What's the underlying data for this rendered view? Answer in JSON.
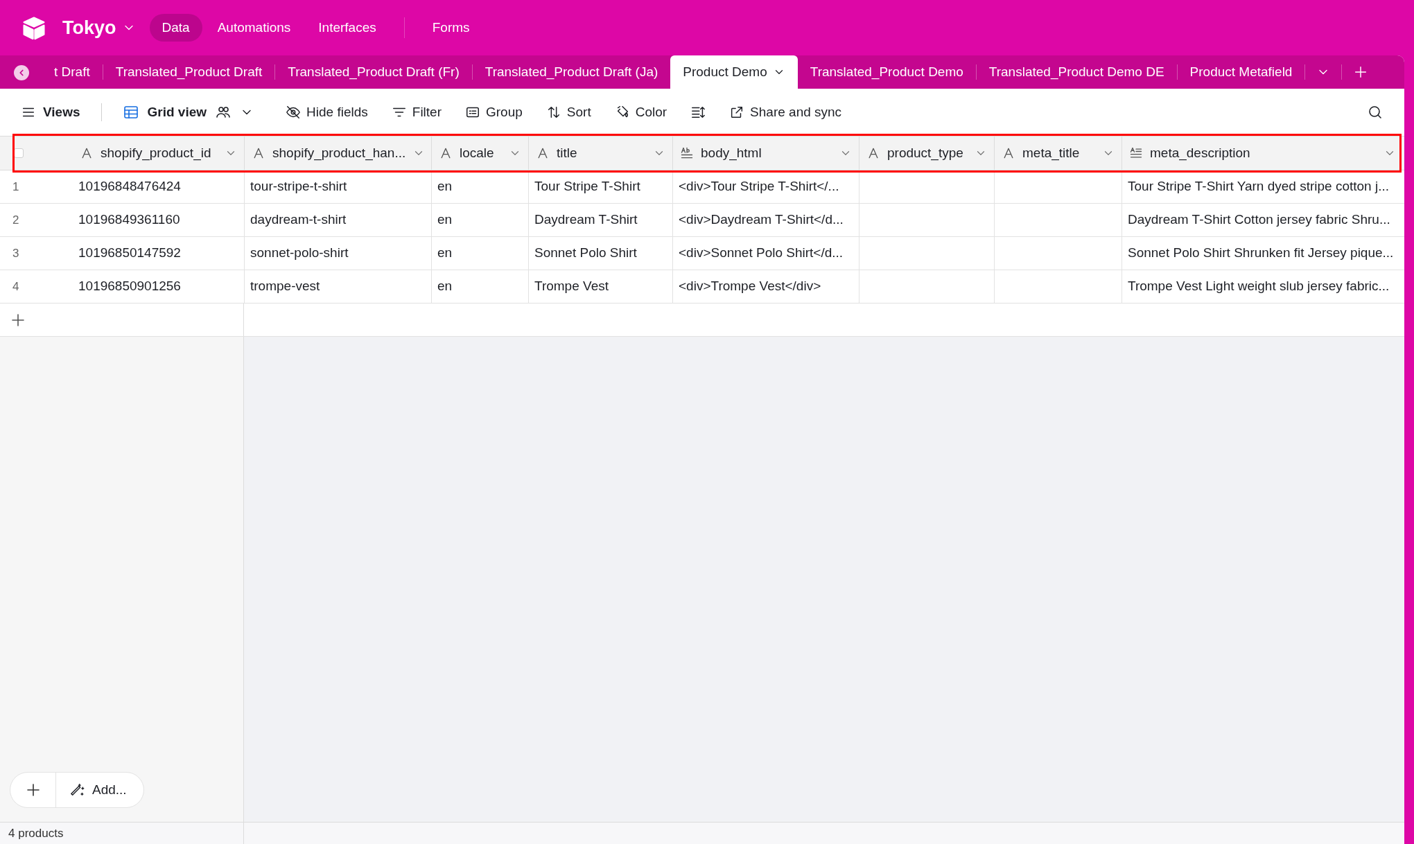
{
  "base": {
    "name": "Tokyo"
  },
  "nav": [
    {
      "label": "Data",
      "selected": true
    },
    {
      "label": "Automations",
      "selected": false
    },
    {
      "label": "Interfaces",
      "selected": false
    },
    {
      "label": "Forms",
      "selected": false
    }
  ],
  "tables": [
    {
      "label": "t Draft",
      "selected": false
    },
    {
      "label": "Translated_Product Draft",
      "selected": false
    },
    {
      "label": "Translated_Product Draft (Fr)",
      "selected": false
    },
    {
      "label": "Translated_Product Draft (Ja)",
      "selected": false
    },
    {
      "label": "Product Demo",
      "selected": true
    },
    {
      "label": "Translated_Product Demo",
      "selected": false
    },
    {
      "label": "Translated_Product Demo DE",
      "selected": false
    },
    {
      "label": "Product Metafield",
      "selected": false
    }
  ],
  "toolbar": {
    "views": "Views",
    "view_name": "Grid view",
    "items": [
      {
        "kind": "hide",
        "label": "Hide fields"
      },
      {
        "kind": "filter",
        "label": "Filter"
      },
      {
        "kind": "group",
        "label": "Group"
      },
      {
        "kind": "sort",
        "label": "Sort"
      },
      {
        "kind": "color",
        "label": "Color"
      },
      {
        "kind": "row_height"
      },
      {
        "kind": "share",
        "label": "Share and sync"
      }
    ]
  },
  "table": {
    "select_all": {
      "checked": false
    },
    "columns": [
      {
        "name": "shopify_product_id",
        "kind": "text"
      },
      {
        "name": "shopify_product_han...",
        "kind": "text"
      },
      {
        "name": "locale",
        "kind": "text"
      },
      {
        "name": "title",
        "kind": "text"
      },
      {
        "name": "body_html",
        "kind": "rich_text"
      },
      {
        "name": "product_type",
        "kind": "text"
      },
      {
        "name": "meta_title",
        "kind": "text"
      },
      {
        "name": "meta_description",
        "kind": "long_text"
      }
    ],
    "rows": [
      {
        "number": "1",
        "cells": [
          "10196848476424",
          "tour-stripe-t-shirt",
          "en",
          "Tour Stripe T-Shirt",
          "<div>Tour Stripe T-Shirt</...",
          null,
          null,
          "Tour Stripe T-Shirt Yarn dyed stripe cotton j..."
        ]
      },
      {
        "number": "2",
        "cells": [
          "10196849361160",
          "daydream-t-shirt",
          "en",
          "Daydream T-Shirt",
          "<div>Daydream T-Shirt</d...",
          null,
          null,
          "Daydream T-Shirt Cotton jersey fabric Shru..."
        ]
      },
      {
        "number": "3",
        "cells": [
          "10196850147592",
          "sonnet-polo-shirt",
          "en",
          "Sonnet Polo Shirt",
          "<div>Sonnet Polo Shirt</d...",
          null,
          null,
          "Sonnet Polo Shirt Shrunken fit Jersey pique..."
        ]
      },
      {
        "number": "4",
        "cells": [
          "10196850901256",
          "trompe-vest",
          "en",
          "Trompe Vest",
          "<div>Trompe Vest</div>",
          null,
          null,
          "Trompe Vest Light weight slub jersey fabric..."
        ]
      }
    ]
  },
  "add_button": "Add...",
  "record_count": "4 products"
}
